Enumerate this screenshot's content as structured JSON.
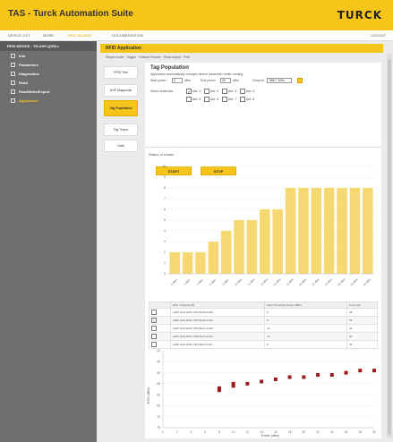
{
  "app": {
    "title": "TAS - Turck Automation Suite",
    "logo": "TURCK"
  },
  "nav": {
    "items": [
      {
        "label": "DEVICE LIST",
        "active": false
      },
      {
        "label": "MORE",
        "active": false
      },
      {
        "label": "RFID WIZARD",
        "active": true
      },
      {
        "label": "DOCUMENTATION",
        "active": false
      }
    ],
    "logout": "LOGOUT"
  },
  "sidebar": {
    "header": "RFID DEVICE - TN-UHF-Q300-L",
    "items": [
      {
        "label": "Info",
        "active": false
      },
      {
        "label": "Parameters",
        "active": false
      },
      {
        "label": "Diagnostics",
        "active": false
      },
      {
        "label": "Read",
        "active": false
      },
      {
        "label": "Read/Write/Export",
        "active": false
      },
      {
        "label": "Application",
        "active": true
      }
    ]
  },
  "main": {
    "header": "RFID Application",
    "breadcrumb": "Report mode · Trigger · Feature Reader · Read output · Print",
    "tabs": [
      {
        "label": "RFID Test",
        "active": false
      },
      {
        "label": "UHF Diagnostic",
        "active": false
      },
      {
        "label": "Tag Population",
        "active": true
      },
      {
        "label": "Tag Tracer",
        "active": false
      },
      {
        "label": "Gate",
        "active": false
      }
    ],
    "panel_title": "Tag Population",
    "description": "Application automatically changes device parameter under running",
    "start_power_label": "Start power",
    "start_power_value": "0",
    "start_power_unit": "dBm",
    "end_power_label": "End power",
    "end_power_value": "30",
    "end_power_unit": "dBm",
    "channel_label": "Channel",
    "channel_value": "865.7 MHz",
    "select_antennas_label": "Select antennas",
    "antennas": [
      {
        "label": "Ant. 1",
        "checked": true
      },
      {
        "label": "Ant. 2",
        "checked": false
      },
      {
        "label": "Ant. 3",
        "checked": false
      },
      {
        "label": "Ant. 4",
        "checked": false
      },
      {
        "label": "Ant. 5",
        "checked": false
      },
      {
        "label": "Ant. 6",
        "checked": false
      },
      {
        "label": "Ant. 7",
        "checked": false
      },
      {
        "label": "Ant. 8",
        "checked": false
      }
    ],
    "start_label": "START",
    "stop_label": "STOP"
  },
  "bar_chart": {
    "ylabel": "Status of reader",
    "yticks": [
      "10",
      "9",
      "8",
      "7",
      "6",
      "5",
      "4",
      "3",
      "2",
      "1",
      "0"
    ],
    "categories": [
      "0 dBm",
      "2 dBm",
      "4 dBm",
      "6 dBm",
      "8 dBm",
      "10 dBm",
      "12 dBm",
      "14 dBm",
      "16 dBm",
      "18 dBm",
      "20 dBm",
      "22 dBm",
      "24 dBm",
      "26 dBm",
      "28 dBm",
      "30 dBm"
    ],
    "values": [
      2,
      2,
      2,
      3,
      4,
      5,
      5,
      6,
      6,
      8,
      8,
      8,
      8,
      8,
      8,
      8
    ]
  },
  "table": {
    "headers": [
      "",
      "EPC / Antenna (#)",
      "Start Threshold Power (dBm)",
      "Count (#)"
    ],
    "rows": [
      {
        "checked": false,
        "epc": "e280 1130 2000 7203 5bd0 Ant#1",
        "thr": "8",
        "cnt": "48"
      },
      {
        "checked": true,
        "epc": "e280 1130 2000 7203 5bd9 Ant#1",
        "thr": "8",
        "cnt": "52"
      },
      {
        "checked": false,
        "epc": "e280 1130 2000 7203 5be0 Ant#1",
        "thr": "10",
        "cnt": "44"
      },
      {
        "checked": false,
        "epc": "e280 1130 2000 7203 5be5 Ant#1",
        "thr": "12",
        "cnt": "40"
      },
      {
        "checked": false,
        "epc": "e280 1130 2000 7203 5bf2 Ant#1",
        "thr": "8",
        "cnt": "46"
      }
    ]
  },
  "scatter_chart": {
    "xlabel": "Power (dBm)",
    "ylabel": "RSSI (dBm)",
    "xticks": [
      "0",
      "2",
      "4",
      "6",
      "8",
      "10",
      "12",
      "14",
      "16",
      "18",
      "20",
      "22",
      "24",
      "26",
      "28",
      "30"
    ],
    "yticks": [
      "-40",
      "-45",
      "-50",
      "-55",
      "-60",
      "-65",
      "-70",
      "-75"
    ],
    "points": [
      {
        "x": 8,
        "y": -57
      },
      {
        "x": 8,
        "y": -58
      },
      {
        "x": 10,
        "y": -56
      },
      {
        "x": 10,
        "y": -55
      },
      {
        "x": 12,
        "y": -55
      },
      {
        "x": 14,
        "y": -54
      },
      {
        "x": 16,
        "y": -53
      },
      {
        "x": 18,
        "y": -52
      },
      {
        "x": 20,
        "y": -52
      },
      {
        "x": 22,
        "y": -51
      },
      {
        "x": 24,
        "y": -51
      },
      {
        "x": 26,
        "y": -50
      },
      {
        "x": 28,
        "y": -49
      },
      {
        "x": 30,
        "y": -49
      }
    ]
  },
  "colors": {
    "accent": "#f6c51a",
    "bar": "#f6d872",
    "marker": "#9b1b1b",
    "sidebar": "#6f6f6f"
  }
}
